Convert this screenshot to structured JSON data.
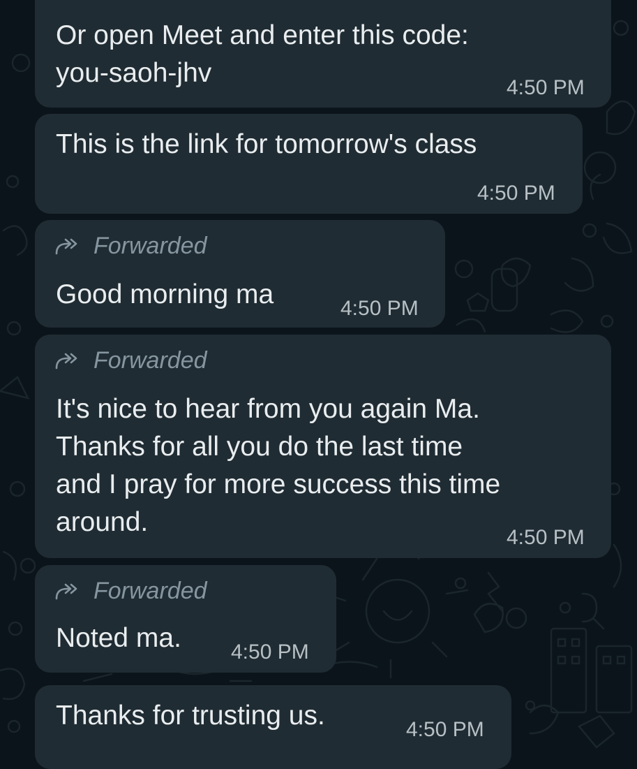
{
  "colors": {
    "background": "#0b141a",
    "bubble": "#202c33",
    "text": "#e9edef",
    "meta": "#b7c0c5",
    "forwarded": "#8696a0"
  },
  "messages": [
    {
      "text_lines": [
        "Or open Meet and enter this code:",
        "you-saoh-jhv"
      ],
      "time": "4:50 PM",
      "forwarded": false
    },
    {
      "text_lines": [
        "This is the link for tomorrow's class"
      ],
      "time": "4:50 PM",
      "forwarded": false
    },
    {
      "forwarded_label": "Forwarded",
      "text_lines": [
        "Good morning ma"
      ],
      "time": "4:50 PM",
      "forwarded": true,
      "forward_icon": "forwarded-arrow-icon"
    },
    {
      "forwarded_label": "Forwarded",
      "text_lines": [
        "It's nice to hear from you again Ma.",
        "Thanks for all you do the last time",
        "and I pray for more success this time",
        "around."
      ],
      "time": "4:50 PM",
      "forwarded": true,
      "forward_icon": "forwarded-arrow-icon"
    },
    {
      "forwarded_label": "Forwarded",
      "text_lines": [
        "Noted ma."
      ],
      "time": "4:50 PM",
      "forwarded": true,
      "forward_icon": "forwarded-arrow-icon"
    },
    {
      "text_lines": [
        "Thanks for trusting us."
      ],
      "time": "4:50 PM",
      "forwarded": false
    }
  ]
}
